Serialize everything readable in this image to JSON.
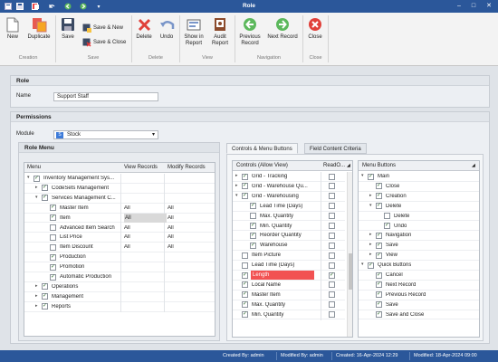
{
  "window": {
    "title": "Role"
  },
  "colors": {
    "titlebar": "#2b579a",
    "statusbar": "#2b579a",
    "highlight": "#f25252"
  },
  "quick_access": [
    "save-icon",
    "save-new-icon",
    "undo-icon",
    "back-icon",
    "forward-icon",
    "dropdown-icon"
  ],
  "ribbon": {
    "new": "New",
    "duplicate": "Duplicate",
    "save": "Save",
    "save_new": "Save & New",
    "save_close": "Save & Close",
    "delete": "Delete",
    "undo": "Undo",
    "show_report": "Show in\nReport",
    "audit_report": "Audit\nReport",
    "prev_record": "Previous\nRecord",
    "next_record": "Next Record",
    "close": "Close",
    "groups": {
      "creation": "Creation",
      "save": "Save",
      "delete": "Delete",
      "view": "View",
      "navigation": "Navigation",
      "close": "Close"
    }
  },
  "role": {
    "header": "Role",
    "name_label": "Name",
    "name_value": "Support Staff"
  },
  "permissions": {
    "header": "Permissions",
    "module_label": "Module",
    "module_value": "Stock",
    "module_icon": "S",
    "role_menu": {
      "header": "Role Menu",
      "columns": [
        "Menu",
        "View Records",
        "Modify Records"
      ],
      "rows": [
        {
          "text": "Inventory Management Sys...",
          "lvl": 0,
          "exp": "▾",
          "cb": true,
          "view": "",
          "modify": ""
        },
        {
          "text": "CodeSets Management",
          "lvl": 1,
          "exp": "▸",
          "cb": true,
          "view": "",
          "modify": ""
        },
        {
          "text": "Services Management C...",
          "lvl": 1,
          "exp": "▾",
          "cb": true,
          "view": "",
          "modify": ""
        },
        {
          "text": "Master Item",
          "lvl": 2,
          "exp": "",
          "cb": true,
          "view": "All",
          "modify": "All"
        },
        {
          "text": "Item",
          "lvl": 2,
          "exp": "",
          "cb": true,
          "view": "All",
          "modify": "All"
        },
        {
          "text": "Advanced Item Search",
          "lvl": 2,
          "exp": "",
          "cb": false,
          "view": "All",
          "modify": "All"
        },
        {
          "text": "List Price",
          "lvl": 2,
          "exp": "",
          "cb": false,
          "view": "All",
          "modify": "All"
        },
        {
          "text": "Item Discount",
          "lvl": 2,
          "exp": "",
          "cb": false,
          "view": "All",
          "modify": "All"
        },
        {
          "text": "Production",
          "lvl": 2,
          "exp": "",
          "cb": true,
          "view": "",
          "modify": ""
        },
        {
          "text": "Promotion",
          "lvl": 2,
          "exp": "",
          "cb": true,
          "view": "",
          "modify": ""
        },
        {
          "text": "Automatic Production",
          "lvl": 2,
          "exp": "",
          "cb": true,
          "view": "",
          "modify": ""
        },
        {
          "text": "Operations",
          "lvl": 1,
          "exp": "▸",
          "cb": true,
          "view": "",
          "modify": ""
        },
        {
          "text": "Management",
          "lvl": 1,
          "exp": "▸",
          "cb": true,
          "view": "",
          "modify": ""
        },
        {
          "text": "Reports",
          "lvl": 1,
          "exp": "▸",
          "cb": true,
          "view": "",
          "modify": ""
        }
      ]
    },
    "tabs": [
      "Controls & Menu Buttons",
      "Field Content Criteria"
    ],
    "controls": {
      "columns": [
        "Controls (Allow View)",
        "ReadO..."
      ],
      "rows": [
        {
          "text": "Grid - Tracking",
          "lvl": 0,
          "exp": "▸",
          "cb": true,
          "ro": false,
          "hl": false
        },
        {
          "text": "Grid - Warehouse Qu...",
          "lvl": 0,
          "exp": "▸",
          "cb": true,
          "ro": false,
          "hl": false
        },
        {
          "text": "Grid - Warehousing",
          "lvl": 0,
          "exp": "▾",
          "cb": true,
          "ro": false,
          "hl": false
        },
        {
          "text": "Lead Time (Days)",
          "lvl": 1,
          "exp": "",
          "cb": true,
          "ro": false,
          "hl": false
        },
        {
          "text": "Max. Quantity",
          "lvl": 1,
          "exp": "",
          "cb": false,
          "ro": false,
          "hl": false
        },
        {
          "text": "Min. Quantity",
          "lvl": 1,
          "exp": "",
          "cb": true,
          "ro": false,
          "hl": false
        },
        {
          "text": "Reorder Quantity",
          "lvl": 1,
          "exp": "",
          "cb": true,
          "ro": false,
          "hl": false
        },
        {
          "text": "Warehouse",
          "lvl": 1,
          "exp": "",
          "cb": true,
          "ro": false,
          "hl": false
        },
        {
          "text": "Item Picture",
          "lvl": 0,
          "exp": "",
          "cb": false,
          "ro": false,
          "hl": false
        },
        {
          "text": "Lead Time (Days)",
          "lvl": 0,
          "exp": "",
          "cb": false,
          "ro": false,
          "hl": false
        },
        {
          "text": "Length",
          "lvl": 0,
          "exp": "",
          "cb": true,
          "ro": true,
          "hl": true
        },
        {
          "text": "Local Name",
          "lvl": 0,
          "exp": "",
          "cb": true,
          "ro": false,
          "hl": false
        },
        {
          "text": "Master Item",
          "lvl": 0,
          "exp": "",
          "cb": true,
          "ro": false,
          "hl": false
        },
        {
          "text": "Max. Quantity",
          "lvl": 0,
          "exp": "",
          "cb": true,
          "ro": false,
          "hl": false
        },
        {
          "text": "Min. Quantity",
          "lvl": 0,
          "exp": "",
          "cb": true,
          "ro": false,
          "hl": false
        }
      ]
    },
    "menu_buttons": {
      "columns": [
        "Menu Buttons"
      ],
      "rows": [
        {
          "text": "Main",
          "lvl": 0,
          "exp": "▾",
          "cb": true
        },
        {
          "text": "Close",
          "lvl": 1,
          "exp": "",
          "cb": true
        },
        {
          "text": "Creation",
          "lvl": 1,
          "exp": "▸",
          "cb": true
        },
        {
          "text": "Delete",
          "lvl": 1,
          "exp": "▾",
          "cb": true
        },
        {
          "text": "Delete",
          "lvl": 2,
          "exp": "",
          "cb": false
        },
        {
          "text": "Undo",
          "lvl": 2,
          "exp": "",
          "cb": true
        },
        {
          "text": "Navigation",
          "lvl": 1,
          "exp": "▸",
          "cb": true
        },
        {
          "text": "Save",
          "lvl": 1,
          "exp": "▸",
          "cb": true
        },
        {
          "text": "View",
          "lvl": 1,
          "exp": "▸",
          "cb": true
        },
        {
          "text": "Quick Buttons",
          "lvl": 0,
          "exp": "▾",
          "cb": true
        },
        {
          "text": "Cancel",
          "lvl": 1,
          "exp": "",
          "cb": true
        },
        {
          "text": "Next Record",
          "lvl": 1,
          "exp": "",
          "cb": true
        },
        {
          "text": "Previous Record",
          "lvl": 1,
          "exp": "",
          "cb": true
        },
        {
          "text": "Save",
          "lvl": 1,
          "exp": "",
          "cb": true
        },
        {
          "text": "Save and Close",
          "lvl": 1,
          "exp": "",
          "cb": true
        }
      ]
    }
  },
  "status": {
    "created_by": "Created By: admin",
    "modified_by": "Modified By: admin",
    "created": "Created: 16-Apr-2024 12:29",
    "modified": "Modified: 18-Apr-2024 09:00"
  }
}
